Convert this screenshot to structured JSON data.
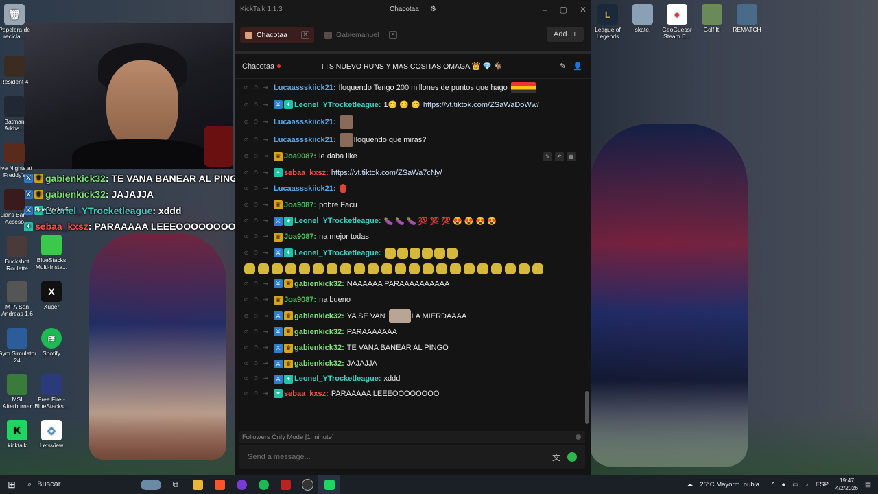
{
  "desktop_left": [
    {
      "label": "Papelera de recicla..."
    },
    {
      "label": "Resident 4"
    },
    {
      "label": "Batman Arkha..."
    },
    {
      "label": "Five Nights at Freddy's"
    },
    {
      "label": "Liar's Bar - Acceso"
    },
    {
      "label": "Buckshot Roulette"
    },
    {
      "label": "MTA San Andreas 1.6"
    },
    {
      "label": "Gym Simulator 24"
    },
    {
      "label": "MSI Afterburner"
    },
    {
      "label": "kicktalk"
    },
    {
      "label": "BlueStacks 5"
    },
    {
      "label": "BlueStacks Multi-Insta..."
    },
    {
      "label": "Xuper"
    },
    {
      "label": "Spotify"
    },
    {
      "label": "Free Fire - BlueStacks..."
    },
    {
      "label": "LetsView"
    }
  ],
  "desktop_right": [
    {
      "label": "League of Legends"
    },
    {
      "label": "skate."
    },
    {
      "label": "GeoGuessr Steam E..."
    },
    {
      "label": "Golf It!"
    },
    {
      "label": "REMATCH"
    }
  ],
  "overlay_chat": [
    {
      "user": "gabienkick32",
      "text": ": TE VANA BANEAR AL PINGO"
    },
    {
      "user": "gabienkick32",
      "text": ": JAJAJJA"
    },
    {
      "user": "Leonel_YTrocketleague",
      "text": ": xddd"
    },
    {
      "user": "sebaa_kxsz",
      "text": ": PARAAAAA LEEEOOOOOOOO"
    }
  ],
  "window": {
    "app_title": "KickTalk 1.1.3",
    "channel_label": "Chacotaa"
  },
  "tabs": [
    {
      "label": "Chacotaa",
      "active": true
    },
    {
      "label": "Gabiemanuel",
      "active": false
    }
  ],
  "add_label": "Add",
  "chat_header": {
    "channel": "Chacotaa",
    "stream_title": "TTS NUEVO RUNS Y MAS COSITAS OMAGA 👑 💎 🐐"
  },
  "messages": [
    {
      "user": "Lucaassskiick21",
      "cls": "u-lucas",
      "text": "!loquendo Tengo 200 millones de puntos que hago",
      "emote": "flag"
    },
    {
      "user": "Leonel_YTrocketleague",
      "cls": "u-leonel",
      "text": "1😊 😊 😊",
      "link": "https://vt.tiktok.com/ZSaWaDoWw/"
    },
    {
      "user": "Lucaassskiick21",
      "cls": "u-lucas",
      "text": "",
      "emote": "img"
    },
    {
      "user": "Lucaassskiick21",
      "cls": "u-lucas",
      "text": "!loquendo que miras?",
      "emote_before": "img"
    },
    {
      "user": "Joa9087",
      "cls": "u-joa",
      "text": "le daba like"
    },
    {
      "user": "sebaa_kxsz",
      "cls": "u-sebaa",
      "text": "",
      "link": "https://vt.tiktok.com/ZSaWa7cNy/"
    },
    {
      "user": "Lucaassskiick21",
      "cls": "u-lucas",
      "text": "",
      "emote": "red"
    },
    {
      "user": "Joa9087",
      "cls": "u-joa",
      "text": "pobre Facu"
    },
    {
      "user": "Leonel_YTrocketleague",
      "cls": "u-leonel",
      "text": "🍆 🍆 🍆 💯 💯 💯 😍 😍 😍 😍"
    },
    {
      "user": "Joa9087",
      "cls": "u-joa",
      "text": "na mejor todas"
    },
    {
      "user": "Leonel_YTrocketleague",
      "cls": "u-leonel",
      "text": "",
      "emote": "hands6"
    },
    {
      "user": "Leonel_YTrocketleague",
      "cls": "u-leonel",
      "text": "",
      "emote": "hands-long"
    },
    {
      "user": "gabienkick32",
      "cls": "u-gabi",
      "text": "NAAAAAA PARAAAAAAAAAA"
    },
    {
      "user": "Joa9087",
      "cls": "u-joa",
      "text": "na bueno"
    },
    {
      "user": "gabienkick32",
      "cls": "u-gabi",
      "text": "YA SE VAN",
      "emote": "cat",
      "text_after": "LA MIERDAAAA"
    },
    {
      "user": "gabienkick32",
      "cls": "u-gabi",
      "text": "PARAAAAAAA"
    },
    {
      "user": "gabienkick32",
      "cls": "u-gabi",
      "text": "TE VANA BANEAR AL PINGO"
    },
    {
      "user": "gabienkick32",
      "cls": "u-gabi",
      "text": "JAJAJJA"
    },
    {
      "user": "Leonel_YTrocketleague",
      "cls": "u-leonel",
      "text": "xddd"
    },
    {
      "user": "sebaa_kxsz",
      "cls": "u-sebaa",
      "text": "PARAAAAA LEEEOOOOOOOO"
    }
  ],
  "follow_mode": "Followers Only Mode [1 minute]",
  "input_placeholder": "Send a message...",
  "taskbar": {
    "search": "Buscar",
    "weather": "25°C  Mayorm. nubla...",
    "lang": "ESP",
    "time": "19:47",
    "date": "4/2/2026"
  }
}
